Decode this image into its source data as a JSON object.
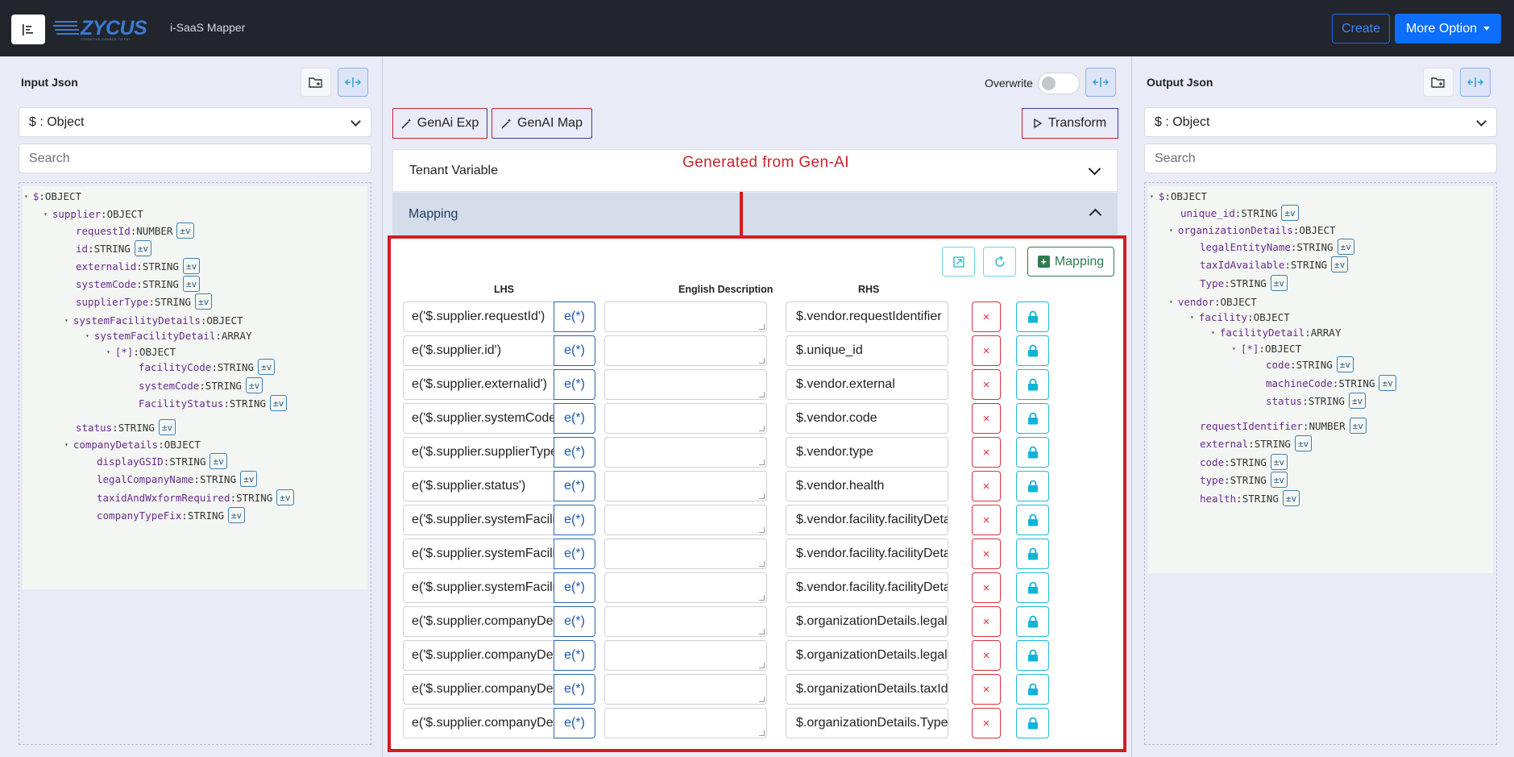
{
  "header": {
    "logo_text": "ZYCUS",
    "logo_sub": "COGNITIVE SOURCE TO PAY",
    "app_title": "i-SaaS Mapper",
    "create_label": "Create",
    "more_label": "More Option"
  },
  "left_panel": {
    "title": "Input Json",
    "select_value": "$ : Object",
    "search_placeholder": "Search",
    "tree": [
      {
        "key": "$",
        "type": "OBJECT",
        "expand": true
      },
      {
        "key": "supplier",
        "type": "OBJECT",
        "expand": true
      },
      {
        "key": "requestId",
        "type": "NUMBER",
        "tv": "±v"
      },
      {
        "key": "id",
        "type": "STRING",
        "tv": "±v"
      },
      {
        "key": "externalid",
        "type": "STRING",
        "tv": "±v"
      },
      {
        "key": "systemCode",
        "type": "STRING",
        "tv": "±v"
      },
      {
        "key": "supplierType",
        "type": "STRING",
        "tv": "±v"
      },
      {
        "key": "systemFacilityDetails",
        "type": "OBJECT",
        "expand": true
      },
      {
        "key": "systemFacilityDetail",
        "type": "ARRAY",
        "expand": true
      },
      {
        "key": "[*]",
        "type": "OBJECT",
        "expand": true
      },
      {
        "key": "facilityCode",
        "type": "STRING",
        "tv": "±v"
      },
      {
        "key": "systemCode",
        "type": "STRING",
        "tv": "±v"
      },
      {
        "key": "FacilityStatus",
        "type": "STRING",
        "tv": "±v"
      },
      {
        "key": "status",
        "type": "STRING",
        "tv": "±v"
      },
      {
        "key": "companyDetails",
        "type": "OBJECT",
        "expand": true
      },
      {
        "key": "displayGSID",
        "type": "STRING",
        "tv": "±v"
      },
      {
        "key": "legalCompanyName",
        "type": "STRING",
        "tv": "±v"
      },
      {
        "key": "taxidAndWxformRequired",
        "type": "STRING",
        "tv": "±v"
      },
      {
        "key": "companyTypeFix",
        "type": "STRING",
        "tv": "±v"
      }
    ]
  },
  "right_panel": {
    "title": "Output Json",
    "select_value": "$ : Object",
    "search_placeholder": "Search",
    "tree": [
      {
        "key": "$",
        "type": "OBJECT",
        "expand": true
      },
      {
        "key": "unique_id",
        "type": "STRING",
        "tv": "±v"
      },
      {
        "key": "organizationDetails",
        "type": "OBJECT",
        "expand": true
      },
      {
        "key": "legalEntityName",
        "type": "STRING",
        "tv": "±v"
      },
      {
        "key": "taxIdAvailable",
        "type": "STRING",
        "tv": "±v"
      },
      {
        "key": "Type",
        "type": "STRING",
        "tv": "±v"
      },
      {
        "key": "vendor",
        "type": "OBJECT",
        "expand": true
      },
      {
        "key": "facility",
        "type": "OBJECT",
        "expand": true
      },
      {
        "key": "facilityDetail",
        "type": "ARRAY",
        "expand": true
      },
      {
        "key": "[*]",
        "type": "OBJECT",
        "expand": true
      },
      {
        "key": "code",
        "type": "STRING",
        "tv": "±v"
      },
      {
        "key": "machineCode",
        "type": "STRING",
        "tv": "±v"
      },
      {
        "key": "status",
        "type": "STRING",
        "tv": "±v"
      },
      {
        "key": "requestIdentifier",
        "type": "NUMBER",
        "tv": "±v"
      },
      {
        "key": "external",
        "type": "STRING",
        "tv": "±v"
      },
      {
        "key": "code",
        "type": "STRING",
        "tv": "±v"
      },
      {
        "key": "type",
        "type": "STRING",
        "tv": "±v"
      },
      {
        "key": "health",
        "type": "STRING",
        "tv": "±v"
      }
    ]
  },
  "middle": {
    "overwrite_label": "Overwrite",
    "genai_exp_label": "GenAi Exp",
    "genai_map_label": "GenAI Map",
    "transform_label": "Transform",
    "tenant_label": "Tenant Variable",
    "mapping_label": "Mapping",
    "gen_note": "Generated from Gen-AI",
    "add_mapping_label": "Mapping",
    "col_lhs": "LHS",
    "col_desc": "English Description",
    "col_rhs": "RHS",
    "e_label": "e(*)",
    "delete_glyph": "×",
    "rows": [
      {
        "lhs": "e('$.supplier.requestId')",
        "rhs": "$.vendor.requestIdentifier"
      },
      {
        "lhs": "e('$.supplier.id')",
        "rhs": "$.unique_id"
      },
      {
        "lhs": "e('$.supplier.externalid')",
        "rhs": "$.vendor.external"
      },
      {
        "lhs": "e('$.supplier.systemCode')",
        "rhs": "$.vendor.code"
      },
      {
        "lhs": "e('$.supplier.supplierType')",
        "rhs": "$.vendor.type"
      },
      {
        "lhs": "e('$.supplier.status')",
        "rhs": "$.vendor.health"
      },
      {
        "lhs": "e('$.supplier.systemFacilityDetails",
        "rhs": "$.vendor.facility.facilityDetail"
      },
      {
        "lhs": "e('$.supplier.systemFacilityDetails",
        "rhs": "$.vendor.facility.facilityDetail"
      },
      {
        "lhs": "e('$.supplier.systemFacilityDetails",
        "rhs": "$.vendor.facility.facilityDetail"
      },
      {
        "lhs": "e('$.supplier.companyDetails",
        "rhs": "$.organizationDetails.legalEntityName"
      },
      {
        "lhs": "e('$.supplier.companyDetails",
        "rhs": "$.organizationDetails.legalEntityName"
      },
      {
        "lhs": "e('$.supplier.companyDetails",
        "rhs": "$.organizationDetails.taxIdAvailable"
      },
      {
        "lhs": "e('$.supplier.companyDetails",
        "rhs": "$.organizationDetails.Type"
      }
    ]
  }
}
